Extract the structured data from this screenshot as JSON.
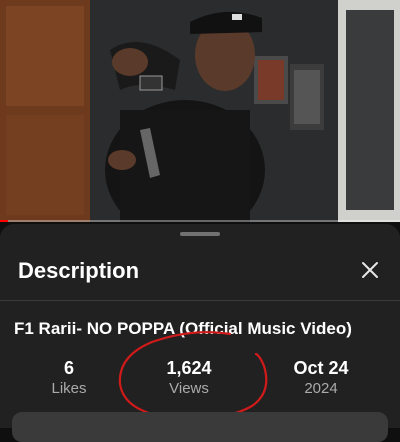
{
  "video": {
    "progress": 0.02
  },
  "description_panel": {
    "heading": "Description",
    "close_icon": "close-icon",
    "video_title": "F1 Rarii- NO POPPA (Official Music Video)",
    "stats": {
      "likes_value": "6",
      "likes_label": "Likes",
      "views_value": "1,624",
      "views_label": "Views",
      "date_value": "Oct 24",
      "date_year": "2024"
    }
  },
  "colors": {
    "background": "#0f0f0f",
    "sheet": "#212121",
    "progress": "#ff0000",
    "annotation": "#d11a1a"
  }
}
